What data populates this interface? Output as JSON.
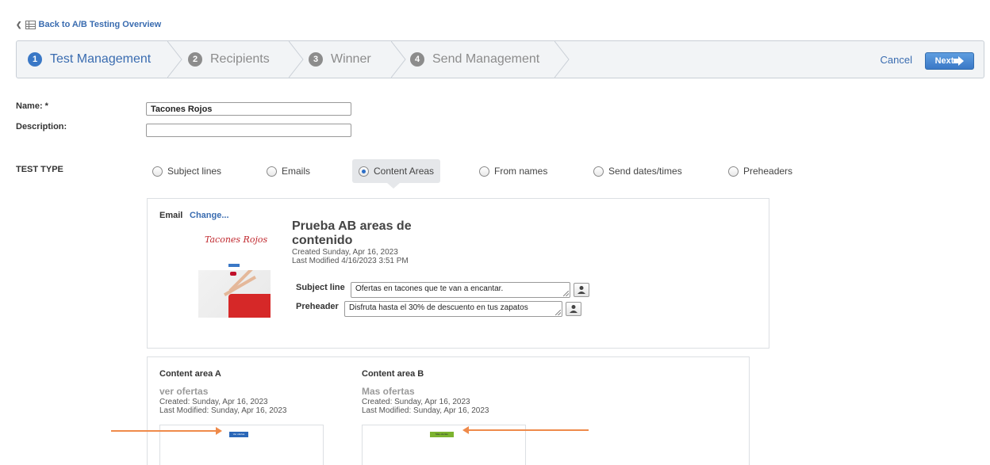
{
  "back_link": {
    "label": "Back to A/B Testing Overview",
    "icon": "list-icon"
  },
  "wizard": {
    "steps": [
      {
        "number": "1",
        "label": "Test Management",
        "active": true
      },
      {
        "number": "2",
        "label": "Recipients",
        "active": false
      },
      {
        "number": "3",
        "label": "Winner",
        "active": false
      },
      {
        "number": "4",
        "label": "Send Management",
        "active": false
      }
    ],
    "cancel_label": "Cancel",
    "next_label": "Next"
  },
  "form": {
    "name_label": "Name: *",
    "name_value": "Tacones Rojos",
    "description_label": "Description:",
    "description_value": ""
  },
  "test_type": {
    "label": "TEST TYPE",
    "options": [
      {
        "label": "Subject lines",
        "checked": false
      },
      {
        "label": "Emails",
        "checked": false
      },
      {
        "label": "Content Areas",
        "checked": true
      },
      {
        "label": "From names",
        "checked": false
      },
      {
        "label": "Send dates/times",
        "checked": false
      },
      {
        "label": "Preheaders",
        "checked": false
      }
    ]
  },
  "email": {
    "label": "Email",
    "change_label": "Change...",
    "thumbnail_logo": "Tacones Rojos",
    "title": "Prueba AB areas de contenido",
    "created": "Created Sunday, Apr 16, 2023",
    "modified": "Last Modified 4/16/2023 3:51 PM",
    "subject_label": "Subject line",
    "subject_value": "Ofertas en tacones que te van a encantar.",
    "preheader_label": "Preheader",
    "preheader_value": "Disfruta hasta el 30% de descuento en tus zapatos"
  },
  "content_areas": [
    {
      "heading": "Content area A",
      "name": "ver ofertas",
      "created": "Created: Sunday, Apr 16, 2023",
      "modified": "Last Modified: Sunday, Apr 16, 2023",
      "button_text": "Ver ofertas",
      "button_color": "#2a67b8"
    },
    {
      "heading": "Content area B",
      "name": "Mas ofertas",
      "created": "Created: Sunday, Apr 16, 2023",
      "modified": "Last Modified: Sunday, Apr 16, 2023",
      "button_text": "Mas ofertas",
      "button_color": "#7cb32f"
    }
  ],
  "colors": {
    "accent": "#3a78c6",
    "link": "#3a6cb0",
    "annotation_arrow": "#ef8a4a"
  }
}
